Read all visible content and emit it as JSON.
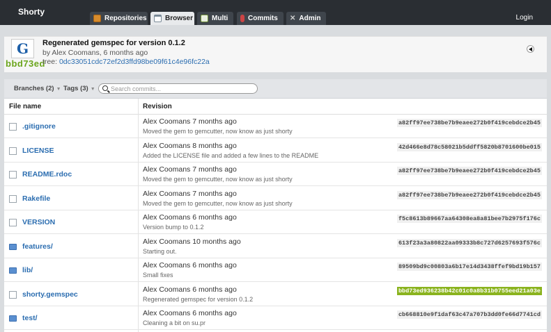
{
  "app": {
    "brand": "Shorty",
    "login_label": "Login"
  },
  "tabs": [
    {
      "label": "Repositories",
      "icon": "repositories-icon"
    },
    {
      "label": "Browser",
      "icon": "browser-icon",
      "active": true
    },
    {
      "label": "Multi",
      "icon": "multi-icon"
    },
    {
      "label": "Commits",
      "icon": "commits-icon"
    },
    {
      "label": "Admin",
      "icon": "admin-icon"
    }
  ],
  "commit": {
    "message": "Regenerated gemspec for version 0.1.2",
    "byline": "by Alex Coomans, 6 months ago",
    "tree_label": "tree:",
    "tree_hash": "0dc33051cdc72ef2d3ffd98be09f61c4e96fc22a",
    "short_sha": "bbd73ed",
    "sha_color": "#6aa51b"
  },
  "filter": {
    "branches_label": "Branches (2)",
    "tags_label": "Tags (3)",
    "search_placeholder": "Search commits..."
  },
  "table": {
    "headers": {
      "file_name": "File name",
      "revision": "Revision"
    },
    "rows": [
      {
        "type": "file",
        "name": ".gitignore",
        "author": "Alex Coomans 7 months ago",
        "message": "Moved the gem to gemcutter, now know as just shorty",
        "sha": "a82ff97ee738be7b9eaee272b0f419cebdce2b45",
        "highlight": false
      },
      {
        "type": "file",
        "name": "LICENSE",
        "author": "Alex Coomans 8 months ago",
        "message": "Added the LICENSE file and added a few lines to the README",
        "sha": "42d466e8d78c58021b5ddff5820b8701600be015",
        "highlight": false
      },
      {
        "type": "file",
        "name": "README.rdoc",
        "author": "Alex Coomans 7 months ago",
        "message": "Moved the gem to gemcutter, now know as just shorty",
        "sha": "a82ff97ee738be7b9eaee272b0f419cebdce2b45",
        "highlight": false
      },
      {
        "type": "file",
        "name": "Rakefile",
        "author": "Alex Coomans 7 months ago",
        "message": "Moved the gem to gemcutter, now know as just shorty",
        "sha": "a82ff97ee738be7b9eaee272b0f419cebdce2b45",
        "highlight": false
      },
      {
        "type": "file",
        "name": "VERSION",
        "author": "Alex Coomans 6 months ago",
        "message": "Version bump to 0.1.2",
        "sha": "f5c8613b89667aa64308ea8a81bee7b2975f176c",
        "highlight": false
      },
      {
        "type": "dir",
        "name": "features/",
        "author": "Alex Coomans 10 months ago",
        "message": "Starting out.",
        "sha": "613f23a3a80822aa09333b8c727d6257693f576c",
        "highlight": false
      },
      {
        "type": "dir",
        "name": "lib/",
        "author": "Alex Coomans 6 months ago",
        "message": "Small fixes",
        "sha": "89509bd9c00803a6b17e14d3438ffef9bd19b157",
        "highlight": false
      },
      {
        "type": "file",
        "name": "shorty.gemspec",
        "author": "Alex Coomans 6 months ago",
        "message": "Regenerated gemspec for version 0.1.2",
        "sha": "bbd73ed936238b42c01c0a8b31b0755eed21a03e",
        "highlight": true
      },
      {
        "type": "dir",
        "name": "test/",
        "author": "Alex Coomans 6 months ago",
        "message": "Cleaning a bit on su.pr",
        "sha": "cb668810e9f1daf63c47a707b3dd0fe66d7741cd",
        "highlight": false
      }
    ]
  }
}
